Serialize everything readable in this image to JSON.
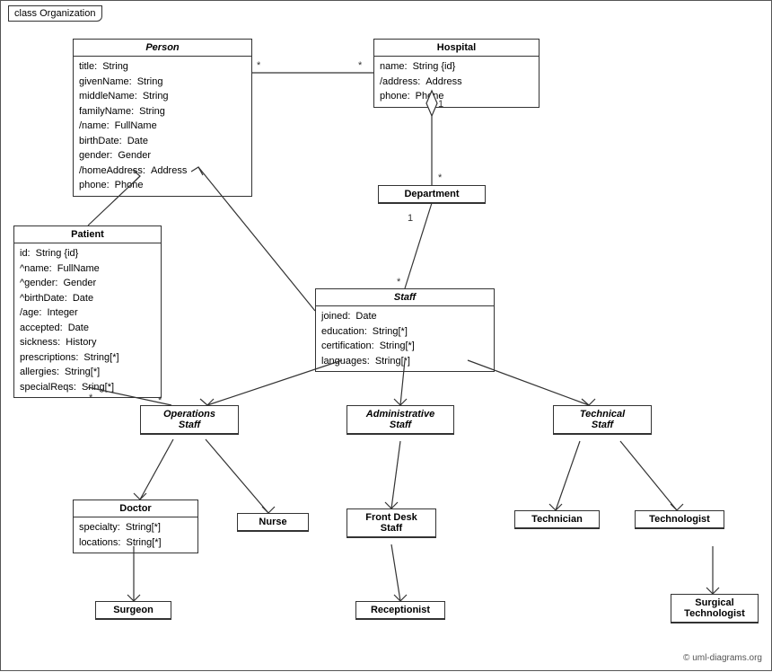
{
  "diagram": {
    "title": "class Organization",
    "copyright": "© uml-diagrams.org",
    "classes": {
      "person": {
        "title": "Person",
        "italic": true,
        "attrs": [
          {
            "name": "title:",
            "type": "String"
          },
          {
            "name": "givenName:",
            "type": "String"
          },
          {
            "name": "middleName:",
            "type": "String"
          },
          {
            "name": "familyName:",
            "type": "String"
          },
          {
            "name": "/name:",
            "type": "FullName"
          },
          {
            "name": "birthDate:",
            "type": "Date"
          },
          {
            "name": "gender:",
            "type": "Gender"
          },
          {
            "name": "/homeAddress:",
            "type": "Address"
          },
          {
            "name": "phone:",
            "type": "Phone"
          }
        ]
      },
      "hospital": {
        "title": "Hospital",
        "italic": false,
        "attrs": [
          {
            "name": "name:",
            "type": "String {id}"
          },
          {
            "name": "/address:",
            "type": "Address"
          },
          {
            "name": "phone:",
            "type": "Phone"
          }
        ]
      },
      "department": {
        "title": "Department",
        "italic": false,
        "attrs": []
      },
      "staff": {
        "title": "Staff",
        "italic": true,
        "attrs": [
          {
            "name": "joined:",
            "type": "Date"
          },
          {
            "name": "education:",
            "type": "String[*]"
          },
          {
            "name": "certification:",
            "type": "String[*]"
          },
          {
            "name": "languages:",
            "type": "String[*]"
          }
        ]
      },
      "patient": {
        "title": "Patient",
        "italic": false,
        "attrs": [
          {
            "name": "id:",
            "type": "String {id}"
          },
          {
            "name": "^name:",
            "type": "FullName"
          },
          {
            "name": "^gender:",
            "type": "Gender"
          },
          {
            "name": "^birthDate:",
            "type": "Date"
          },
          {
            "name": "/age:",
            "type": "Integer"
          },
          {
            "name": "accepted:",
            "type": "Date"
          },
          {
            "name": "sickness:",
            "type": "History"
          },
          {
            "name": "prescriptions:",
            "type": "String[*]"
          },
          {
            "name": "allergies:",
            "type": "String[*]"
          },
          {
            "name": "specialReqs:",
            "type": "Sring[*]"
          }
        ]
      },
      "operations_staff": {
        "title": "Operations Staff",
        "italic": true,
        "attrs": []
      },
      "administrative_staff": {
        "title": "Administrative Staff",
        "italic": true,
        "attrs": []
      },
      "technical_staff": {
        "title": "Technical Staff",
        "italic": true,
        "attrs": []
      },
      "doctor": {
        "title": "Doctor",
        "italic": false,
        "attrs": [
          {
            "name": "specialty:",
            "type": "String[*]"
          },
          {
            "name": "locations:",
            "type": "String[*]"
          }
        ]
      },
      "nurse": {
        "title": "Nurse",
        "italic": false,
        "attrs": []
      },
      "front_desk_staff": {
        "title": "Front Desk Staff",
        "italic": false,
        "attrs": []
      },
      "technician": {
        "title": "Technician",
        "italic": false,
        "attrs": []
      },
      "technologist": {
        "title": "Technologist",
        "italic": false,
        "attrs": []
      },
      "surgeon": {
        "title": "Surgeon",
        "italic": false,
        "attrs": []
      },
      "receptionist": {
        "title": "Receptionist",
        "italic": false,
        "attrs": []
      },
      "surgical_technologist": {
        "title": "Surgical Technologist",
        "italic": false,
        "attrs": []
      }
    }
  }
}
